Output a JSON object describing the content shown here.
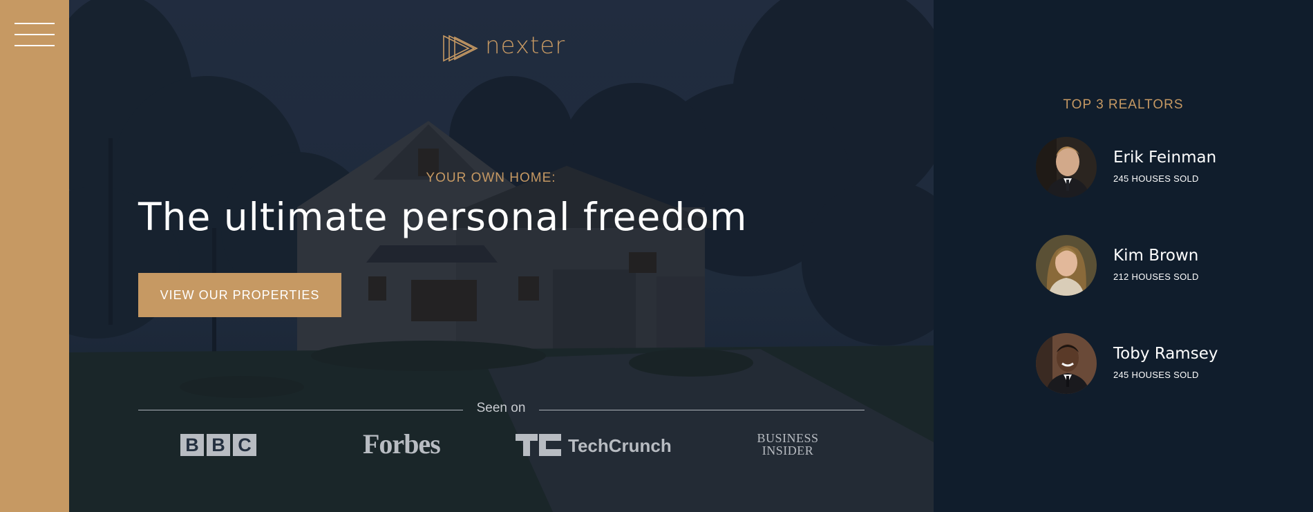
{
  "sidebar": {
    "menu_icon": "hamburger-menu-icon"
  },
  "header": {
    "logo_text": "nexter",
    "logo_icon": "triple-triangle-logo-icon",
    "subtitle": "YOUR OWN HOME:",
    "title": "The ultimate personal freedom",
    "cta_label": "VIEW OUR PROPERTIES",
    "seen_on_label": "Seen on",
    "brands": {
      "bbc": [
        "B",
        "B",
        "C"
      ],
      "forbes": "Forbes",
      "techcrunch": "TechCrunch",
      "business_insider_line1": "BUSINESS",
      "business_insider_line2": "INSIDER"
    }
  },
  "realtors": {
    "title": "TOP 3 REALTORS",
    "items": [
      {
        "name": "Erik Feinman",
        "sold": "245 HOUSES SOLD"
      },
      {
        "name": "Kim Brown",
        "sold": "212 HOUSES SOLD"
      },
      {
        "name": "Toby Ramsey",
        "sold": "245 HOUSES SOLD"
      }
    ]
  },
  "colors": {
    "primary": "#c69963",
    "dark": "#101d2c",
    "white": "#ffffff"
  }
}
